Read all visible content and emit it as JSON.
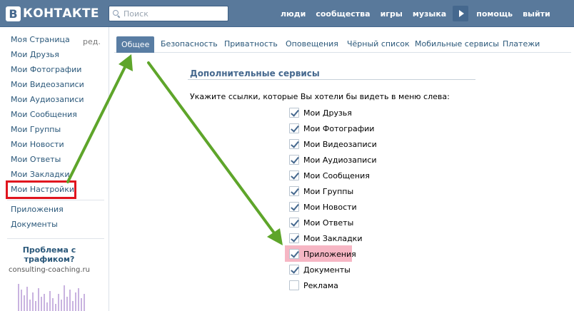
{
  "header": {
    "logo_letter": "В",
    "logo_text": "КОНТАКТЕ",
    "search_placeholder": "Поиск",
    "nav": {
      "people": "люди",
      "communities": "сообщества",
      "games": "игры",
      "music": "музыка",
      "help": "помощь",
      "logout": "выйти"
    },
    "colors": {
      "bar": "#59799b",
      "link": "#2b587a"
    }
  },
  "sidebar": {
    "edit": "ред.",
    "items": [
      "Моя Страница",
      "Мои Друзья",
      "Мои Фотографии",
      "Мои Видеозаписи",
      "Мои Аудиозаписи",
      "Мои Сообщения",
      "Мои Группы",
      "Мои Новости",
      "Мои Ответы",
      "Мои Закладки",
      "Мои Настройки"
    ],
    "extra_items": [
      "Приложения",
      "Документы"
    ],
    "ad": {
      "title": "Проблема с трафиком?",
      "domain": "consulting-coaching.ru"
    }
  },
  "tabs": [
    "Общее",
    "Безопасность",
    "Приватность",
    "Оповещения",
    "Чёрный список",
    "Мобильные сервисы",
    "Платежи"
  ],
  "active_tab": "Общее",
  "services": {
    "title": "Дополнительные сервисы",
    "prompt": "Укажите ссылки, которые Вы хотели бы видеть в меню слева:",
    "options": [
      {
        "label": "Мои Друзья",
        "checked": true
      },
      {
        "label": "Мои Фотографии",
        "checked": true
      },
      {
        "label": "Мои Видеозаписи",
        "checked": true
      },
      {
        "label": "Мои Аудиозаписи",
        "checked": true
      },
      {
        "label": "Мои Сообщения",
        "checked": true
      },
      {
        "label": "Мои Группы",
        "checked": true
      },
      {
        "label": "Мои Новости",
        "checked": true
      },
      {
        "label": "Мои Ответы",
        "checked": true
      },
      {
        "label": "Мои Закладки",
        "checked": true
      },
      {
        "label": "Приложения",
        "checked": true,
        "highlighted": true
      },
      {
        "label": "Документы",
        "checked": true
      },
      {
        "label": "Реклама",
        "checked": false
      }
    ]
  },
  "annotations": {
    "arrow_color": "#5ea52a",
    "box_color": "#e0141e",
    "highlight_color": "#f6b6c4"
  }
}
